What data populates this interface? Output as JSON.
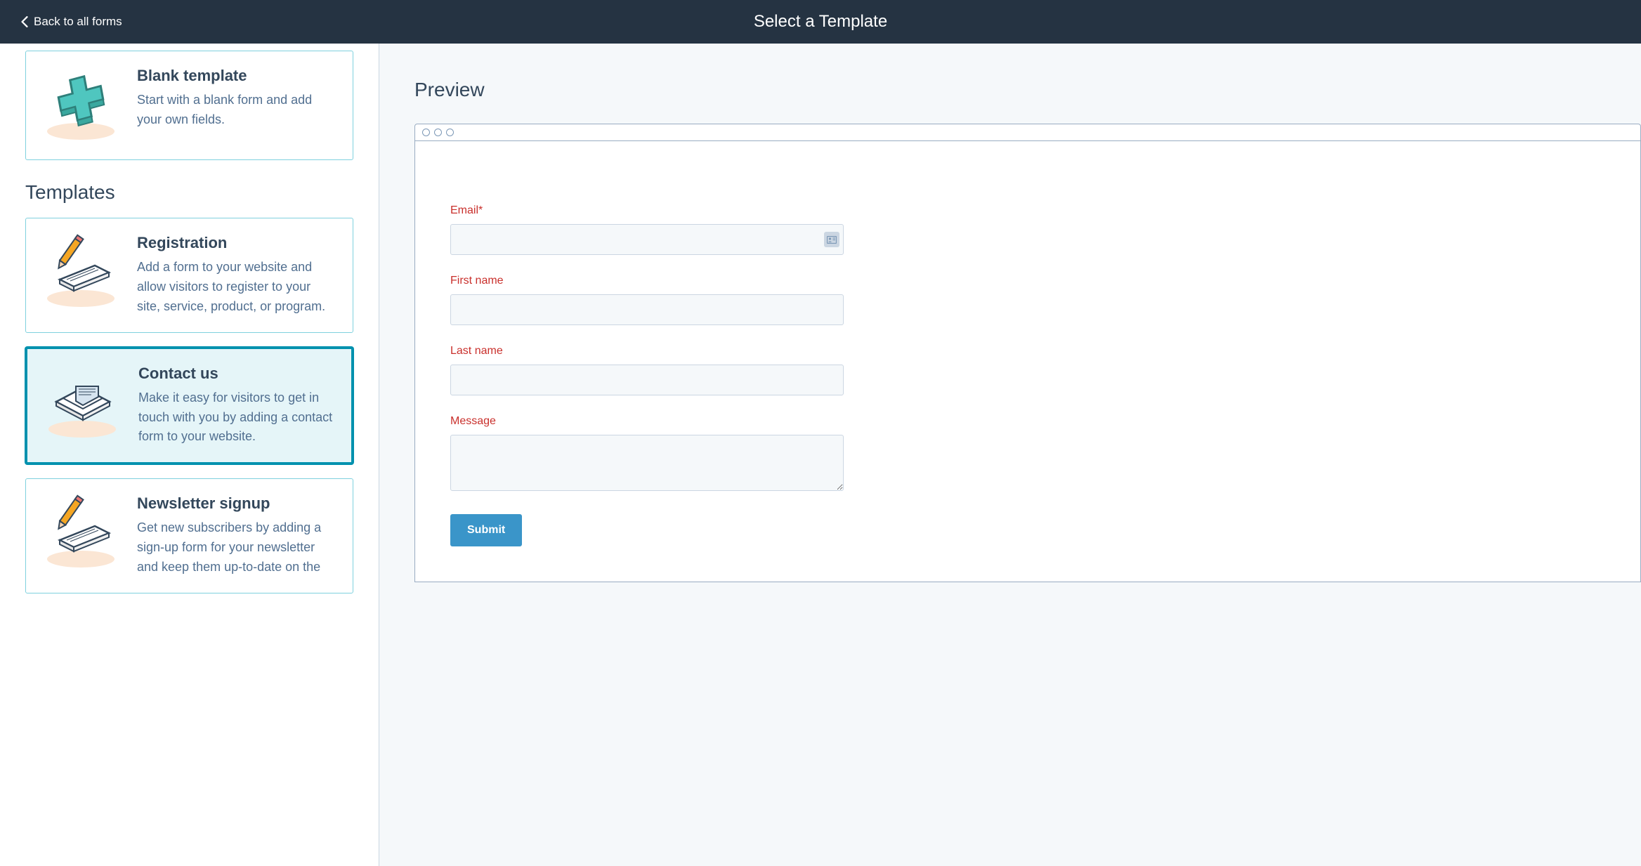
{
  "header": {
    "back_label": "Back to all forms",
    "page_title": "Select a Template"
  },
  "sidebar": {
    "blank": {
      "title": "Blank template",
      "description": "Start with a blank form and add your own fields."
    },
    "section_title": "Templates",
    "templates": [
      {
        "id": "registration",
        "title": "Registration",
        "description": "Add a form to your website and allow visitors to register to your site, service, product, or program.",
        "icon": "pencil-page-icon",
        "selected": false
      },
      {
        "id": "contact-us",
        "title": "Contact us",
        "description": "Make it easy for visitors to get in touch with you by adding a contact form to your website.",
        "icon": "envelope-icon",
        "selected": true
      },
      {
        "id": "newsletter-signup",
        "title": "Newsletter signup",
        "description": "Get new subscribers by adding a sign-up form for your newsletter and keep them up-to-date on the",
        "icon": "pencil-page-icon",
        "selected": false
      }
    ]
  },
  "preview": {
    "title": "Preview",
    "form": {
      "fields": [
        {
          "label": "Email*",
          "type": "text",
          "has_contact_icon": true
        },
        {
          "label": "First name",
          "type": "text",
          "has_contact_icon": false
        },
        {
          "label": "Last name",
          "type": "text",
          "has_contact_icon": false
        },
        {
          "label": "Message",
          "type": "textarea",
          "has_contact_icon": false
        }
      ],
      "submit_label": "Submit"
    }
  }
}
